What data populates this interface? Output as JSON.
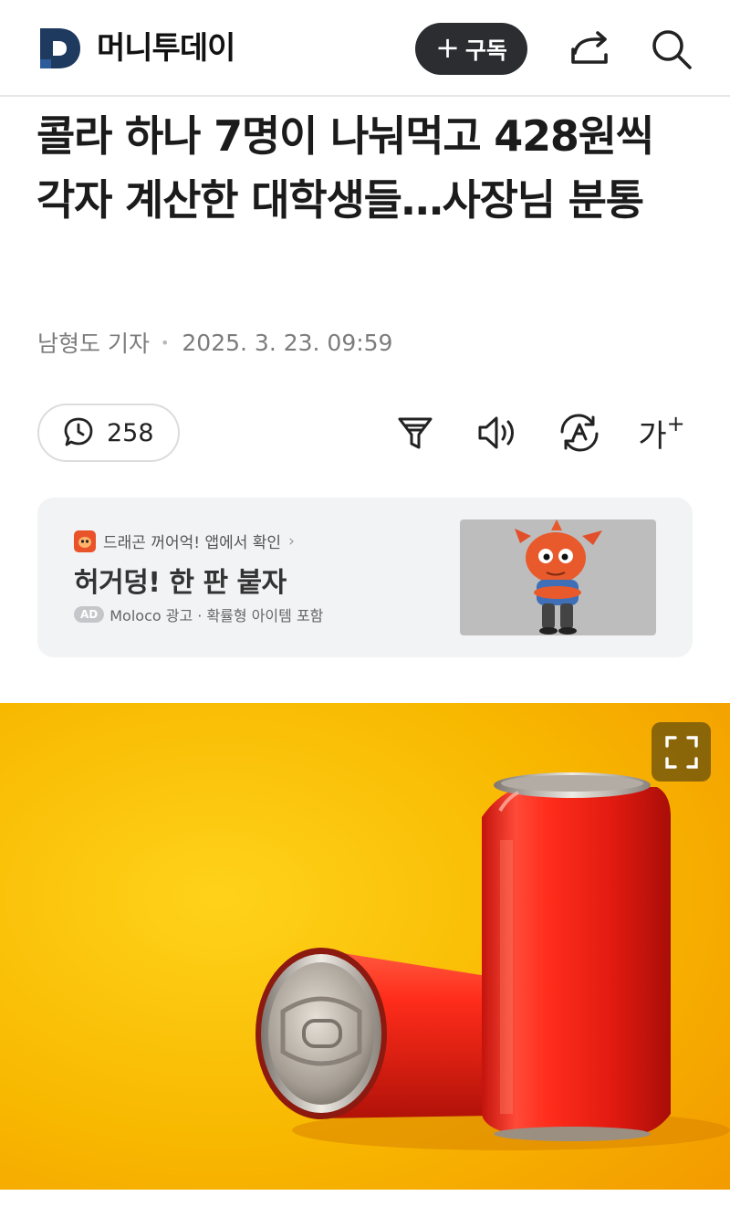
{
  "header": {
    "brand": "머니투데이",
    "subscribe_label": "구독",
    "subscribe_plus": "+"
  },
  "article": {
    "headline": "콜라 하나 7명이 나눠먹고 428원씩 각자 계산한 대학생들…사장님 분통",
    "reporter": "남형도 기자",
    "date": "2025. 3. 23. 09:59"
  },
  "toolbar": {
    "comment_count": "258",
    "font_label": "가",
    "font_plus": "+"
  },
  "ad": {
    "source": "드래곤 꺼어억! 앱에서 확인",
    "title": "허거덩! 한 판 붙자",
    "badge": "AD",
    "footer": "Moloco 광고 · 확률형 아이템 포함"
  },
  "colors": {
    "brand_navy": "#1f3a5f",
    "subscribe_bg": "#2b2d31",
    "hero_yellow": "#f7b500",
    "can_red": "#e8231a"
  }
}
